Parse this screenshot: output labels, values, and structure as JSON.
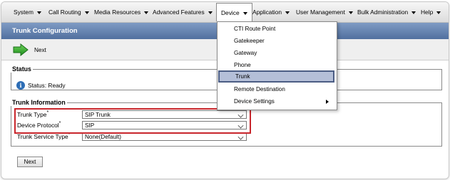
{
  "menu": {
    "items": [
      {
        "label": "System"
      },
      {
        "label": "Call Routing"
      },
      {
        "label": "Media Resources"
      },
      {
        "label": "Advanced Features"
      },
      {
        "label": "Device"
      },
      {
        "label": "Application"
      },
      {
        "label": "User Management"
      },
      {
        "label": "Bulk Administration"
      },
      {
        "label": "Help"
      }
    ]
  },
  "device_menu": {
    "items": [
      {
        "label": "CTI Route Point"
      },
      {
        "label": "Gatekeeper"
      },
      {
        "label": "Gateway"
      },
      {
        "label": "Phone"
      },
      {
        "label": "Trunk"
      },
      {
        "label": "Remote Destination"
      },
      {
        "label": "Device Settings"
      }
    ],
    "selected": "Trunk"
  },
  "page": {
    "title": "Trunk Configuration",
    "toolbar_next": "Next"
  },
  "status": {
    "legend": "Status",
    "text": "Status: Ready",
    "icon": "info-icon"
  },
  "trunk_info": {
    "legend": "Trunk Information",
    "fields": [
      {
        "label": "Trunk Type",
        "required": "*",
        "value": "SIP Trunk"
      },
      {
        "label": "Device Protocol",
        "required": "*",
        "value": "SIP"
      },
      {
        "label": "Trunk Service Type",
        "required": "*",
        "value": "None(Default)"
      }
    ]
  },
  "footer": {
    "next_label": "Next"
  },
  "colors": {
    "title_bar": "#5f7fae",
    "highlight": "#c8262c",
    "selected_item": "#b4bfd8"
  }
}
